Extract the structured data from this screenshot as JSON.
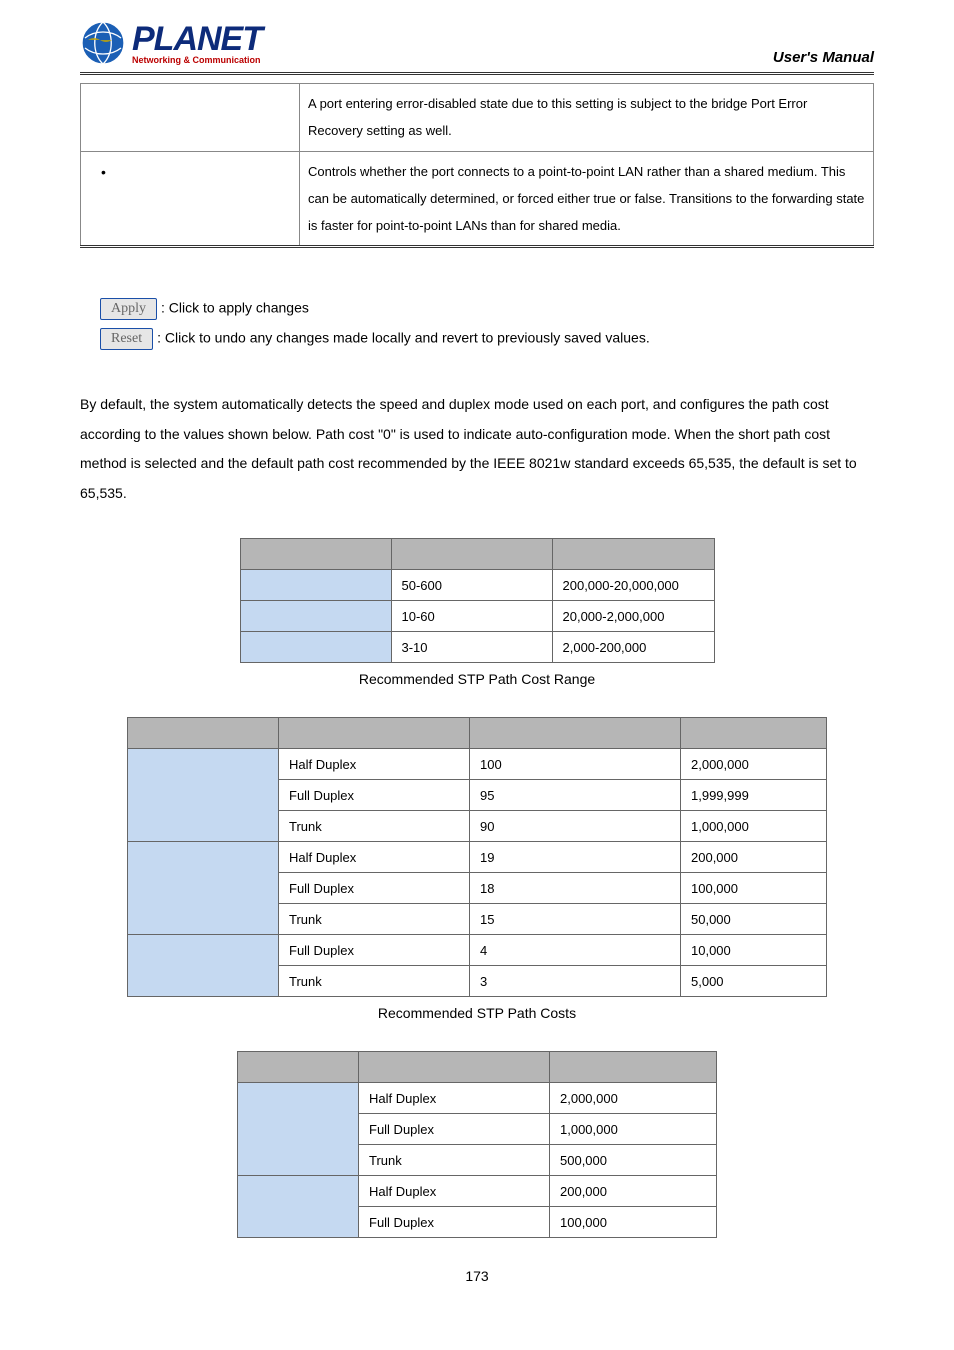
{
  "header": {
    "logo_main": "PLANET",
    "logo_sub": "Networking & Communication",
    "manual_title": "User's Manual"
  },
  "top_table": {
    "row1": "A port entering error-disabled state due to this setting is subject to the bridge Port Error Recovery setting as well.",
    "row2": "Controls whether the port connects to a point-to-point LAN rather than a shared medium. This can be automatically determined, or forced either true or false. Transitions to the forwarding state is faster for point-to-point LANs than for shared media."
  },
  "buttons": {
    "apply_label": "Apply",
    "apply_desc": ": Click to apply changes",
    "reset_label": "Reset",
    "reset_desc": ": Click to undo any changes made locally and revert to previously saved values."
  },
  "paragraph": "By default, the system automatically detects the speed and duplex mode used on each port, and configures the path cost according to the values shown below. Path cost \"0\" is used to indicate auto-configuration mode. When the short path cost method is selected and the default path cost recommended by the IEEE 8021w standard exceeds 65,535, the default is set to 65,535.",
  "table1": {
    "rows": [
      {
        "c1": "50-600",
        "c2": "200,000-20,000,000"
      },
      {
        "c1": "10-60",
        "c2": "20,000-2,000,000"
      },
      {
        "c1": "3-10",
        "c2": "2,000-200,000"
      }
    ],
    "caption": "Recommended STP Path Cost Range"
  },
  "table2": {
    "groups": [
      {
        "rows": [
          {
            "a": "Half Duplex",
            "b": "100",
            "c": "2,000,000"
          },
          {
            "a": "Full Duplex",
            "b": "95",
            "c": "1,999,999"
          },
          {
            "a": "Trunk",
            "b": "90",
            "c": "1,000,000"
          }
        ]
      },
      {
        "rows": [
          {
            "a": "Half Duplex",
            "b": "19",
            "c": "200,000"
          },
          {
            "a": "Full Duplex",
            "b": "18",
            "c": "100,000"
          },
          {
            "a": "Trunk",
            "b": "15",
            "c": "50,000"
          }
        ]
      },
      {
        "rows": [
          {
            "a": "Full Duplex",
            "b": "4",
            "c": "10,000"
          },
          {
            "a": "Trunk",
            "b": "3",
            "c": "5,000"
          }
        ]
      }
    ],
    "caption": "Recommended STP Path Costs"
  },
  "table3": {
    "groups": [
      {
        "rows": [
          {
            "a": "Half Duplex",
            "b": "2,000,000"
          },
          {
            "a": "Full Duplex",
            "b": "1,000,000"
          },
          {
            "a": "Trunk",
            "b": "500,000"
          }
        ]
      },
      {
        "rows": [
          {
            "a": "Half Duplex",
            "b": "200,000"
          },
          {
            "a": "Full Duplex",
            "b": "100,000"
          }
        ]
      }
    ]
  },
  "page_number": "173"
}
